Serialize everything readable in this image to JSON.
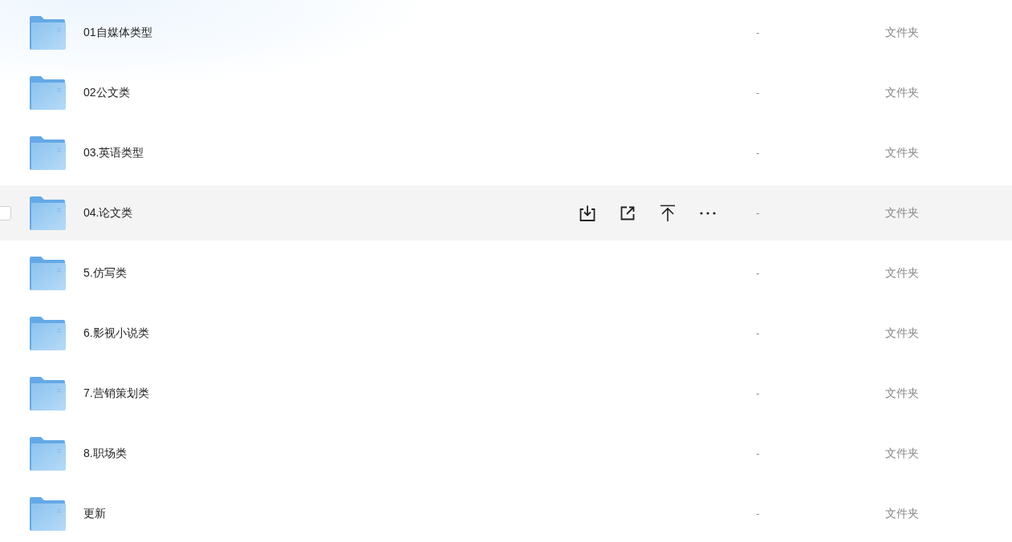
{
  "files": [
    {
      "name": "01自媒体类型",
      "size": "-",
      "type": "文件夹",
      "hovered": false
    },
    {
      "name": "02公文类",
      "size": "-",
      "type": "文件夹",
      "hovered": false
    },
    {
      "name": "03.英语类型",
      "size": "-",
      "type": "文件夹",
      "hovered": false
    },
    {
      "name": "04.论文类",
      "size": "-",
      "type": "文件夹",
      "hovered": true
    },
    {
      "name": "5.仿写类",
      "size": "-",
      "type": "文件夹",
      "hovered": false
    },
    {
      "name": "6.影视小说类",
      "size": "-",
      "type": "文件夹",
      "hovered": false
    },
    {
      "name": "7.营销策划类",
      "size": "-",
      "type": "文件夹",
      "hovered": false
    },
    {
      "name": "8.职场类",
      "size": "-",
      "type": "文件夹",
      "hovered": false
    },
    {
      "name": "更新",
      "size": "-",
      "type": "文件夹",
      "hovered": false
    }
  ]
}
